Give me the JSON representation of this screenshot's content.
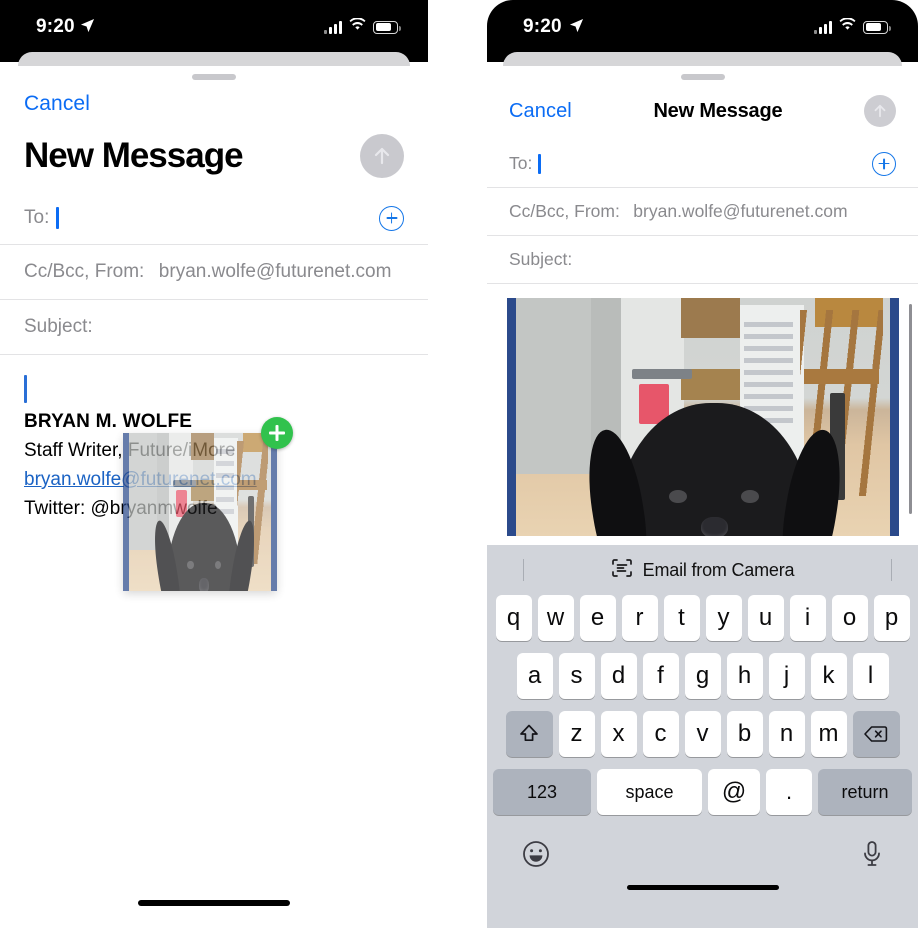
{
  "status_bar": {
    "time": "9:20",
    "location_icon": "location-arrow-icon",
    "signal_icon": "cellular-signal-icon",
    "wifi_icon": "wifi-icon",
    "battery_icon": "battery-icon"
  },
  "left_panel": {
    "cancel_label": "Cancel",
    "title": "New Message",
    "send_icon": "send-arrow-up-icon",
    "send_enabled": false,
    "fields": {
      "to_label": "To:",
      "to_value": "",
      "add_contact_icon": "add-contact-plus-icon",
      "cc_bcc_from_label": "Cc/Bcc, From:",
      "from_value": "bryan.wolfe@futurenet.com",
      "subject_label": "Subject:",
      "subject_value": ""
    },
    "signature": {
      "name": "BRYAN M. WOLFE",
      "role": "Staff Writer, Future/iMore",
      "email": "bryan.wolfe@futurenet.com",
      "twitter": "Twitter: @bryanmwolfe"
    },
    "drag": {
      "thumbnail_name": "dragged-photo-thumbnail",
      "badge_icon": "green-plus-badge-icon",
      "badge_color": "#31c24d"
    }
  },
  "right_panel": {
    "cancel_label": "Cancel",
    "title": "New Message",
    "send_icon": "send-arrow-up-icon",
    "send_enabled": false,
    "fields": {
      "to_label": "To:",
      "to_value": "",
      "add_contact_icon": "add-contact-plus-icon",
      "cc_bcc_from_label": "Cc/Bcc, From:",
      "from_value": "bryan.wolfe@futurenet.com",
      "subject_label": "Subject:",
      "subject_value": ""
    },
    "attachment": {
      "name": "inserted-photo-dog-in-kitchen",
      "border_color": "#2b4a8b"
    },
    "keyboard": {
      "toolbar": {
        "scan_icon": "text-scan-icon",
        "label": "Email from Camera"
      },
      "row1": [
        "q",
        "w",
        "e",
        "r",
        "t",
        "y",
        "u",
        "i",
        "o",
        "p"
      ],
      "row2": [
        "a",
        "s",
        "d",
        "f",
        "g",
        "h",
        "j",
        "k",
        "l"
      ],
      "row3": [
        "z",
        "x",
        "c",
        "v",
        "b",
        "n",
        "m"
      ],
      "shift_icon": "shift-arrow-up-icon",
      "backspace_icon": "backspace-delete-icon",
      "numbers_label": "123",
      "space_label": "space",
      "at_label": "@",
      "period_label": ".",
      "return_label": "return",
      "emoji_icon": "emoji-smiley-icon",
      "mic_icon": "microphone-icon"
    }
  },
  "colors": {
    "accent_blue": "#0b6cf4",
    "keyboard_bg": "#d1d4da",
    "key_bg": "#ffffff",
    "mod_key_bg": "#adb3bd",
    "disabled_send": "#c9c9ce",
    "placeholder_gray": "#8a8a8e"
  }
}
